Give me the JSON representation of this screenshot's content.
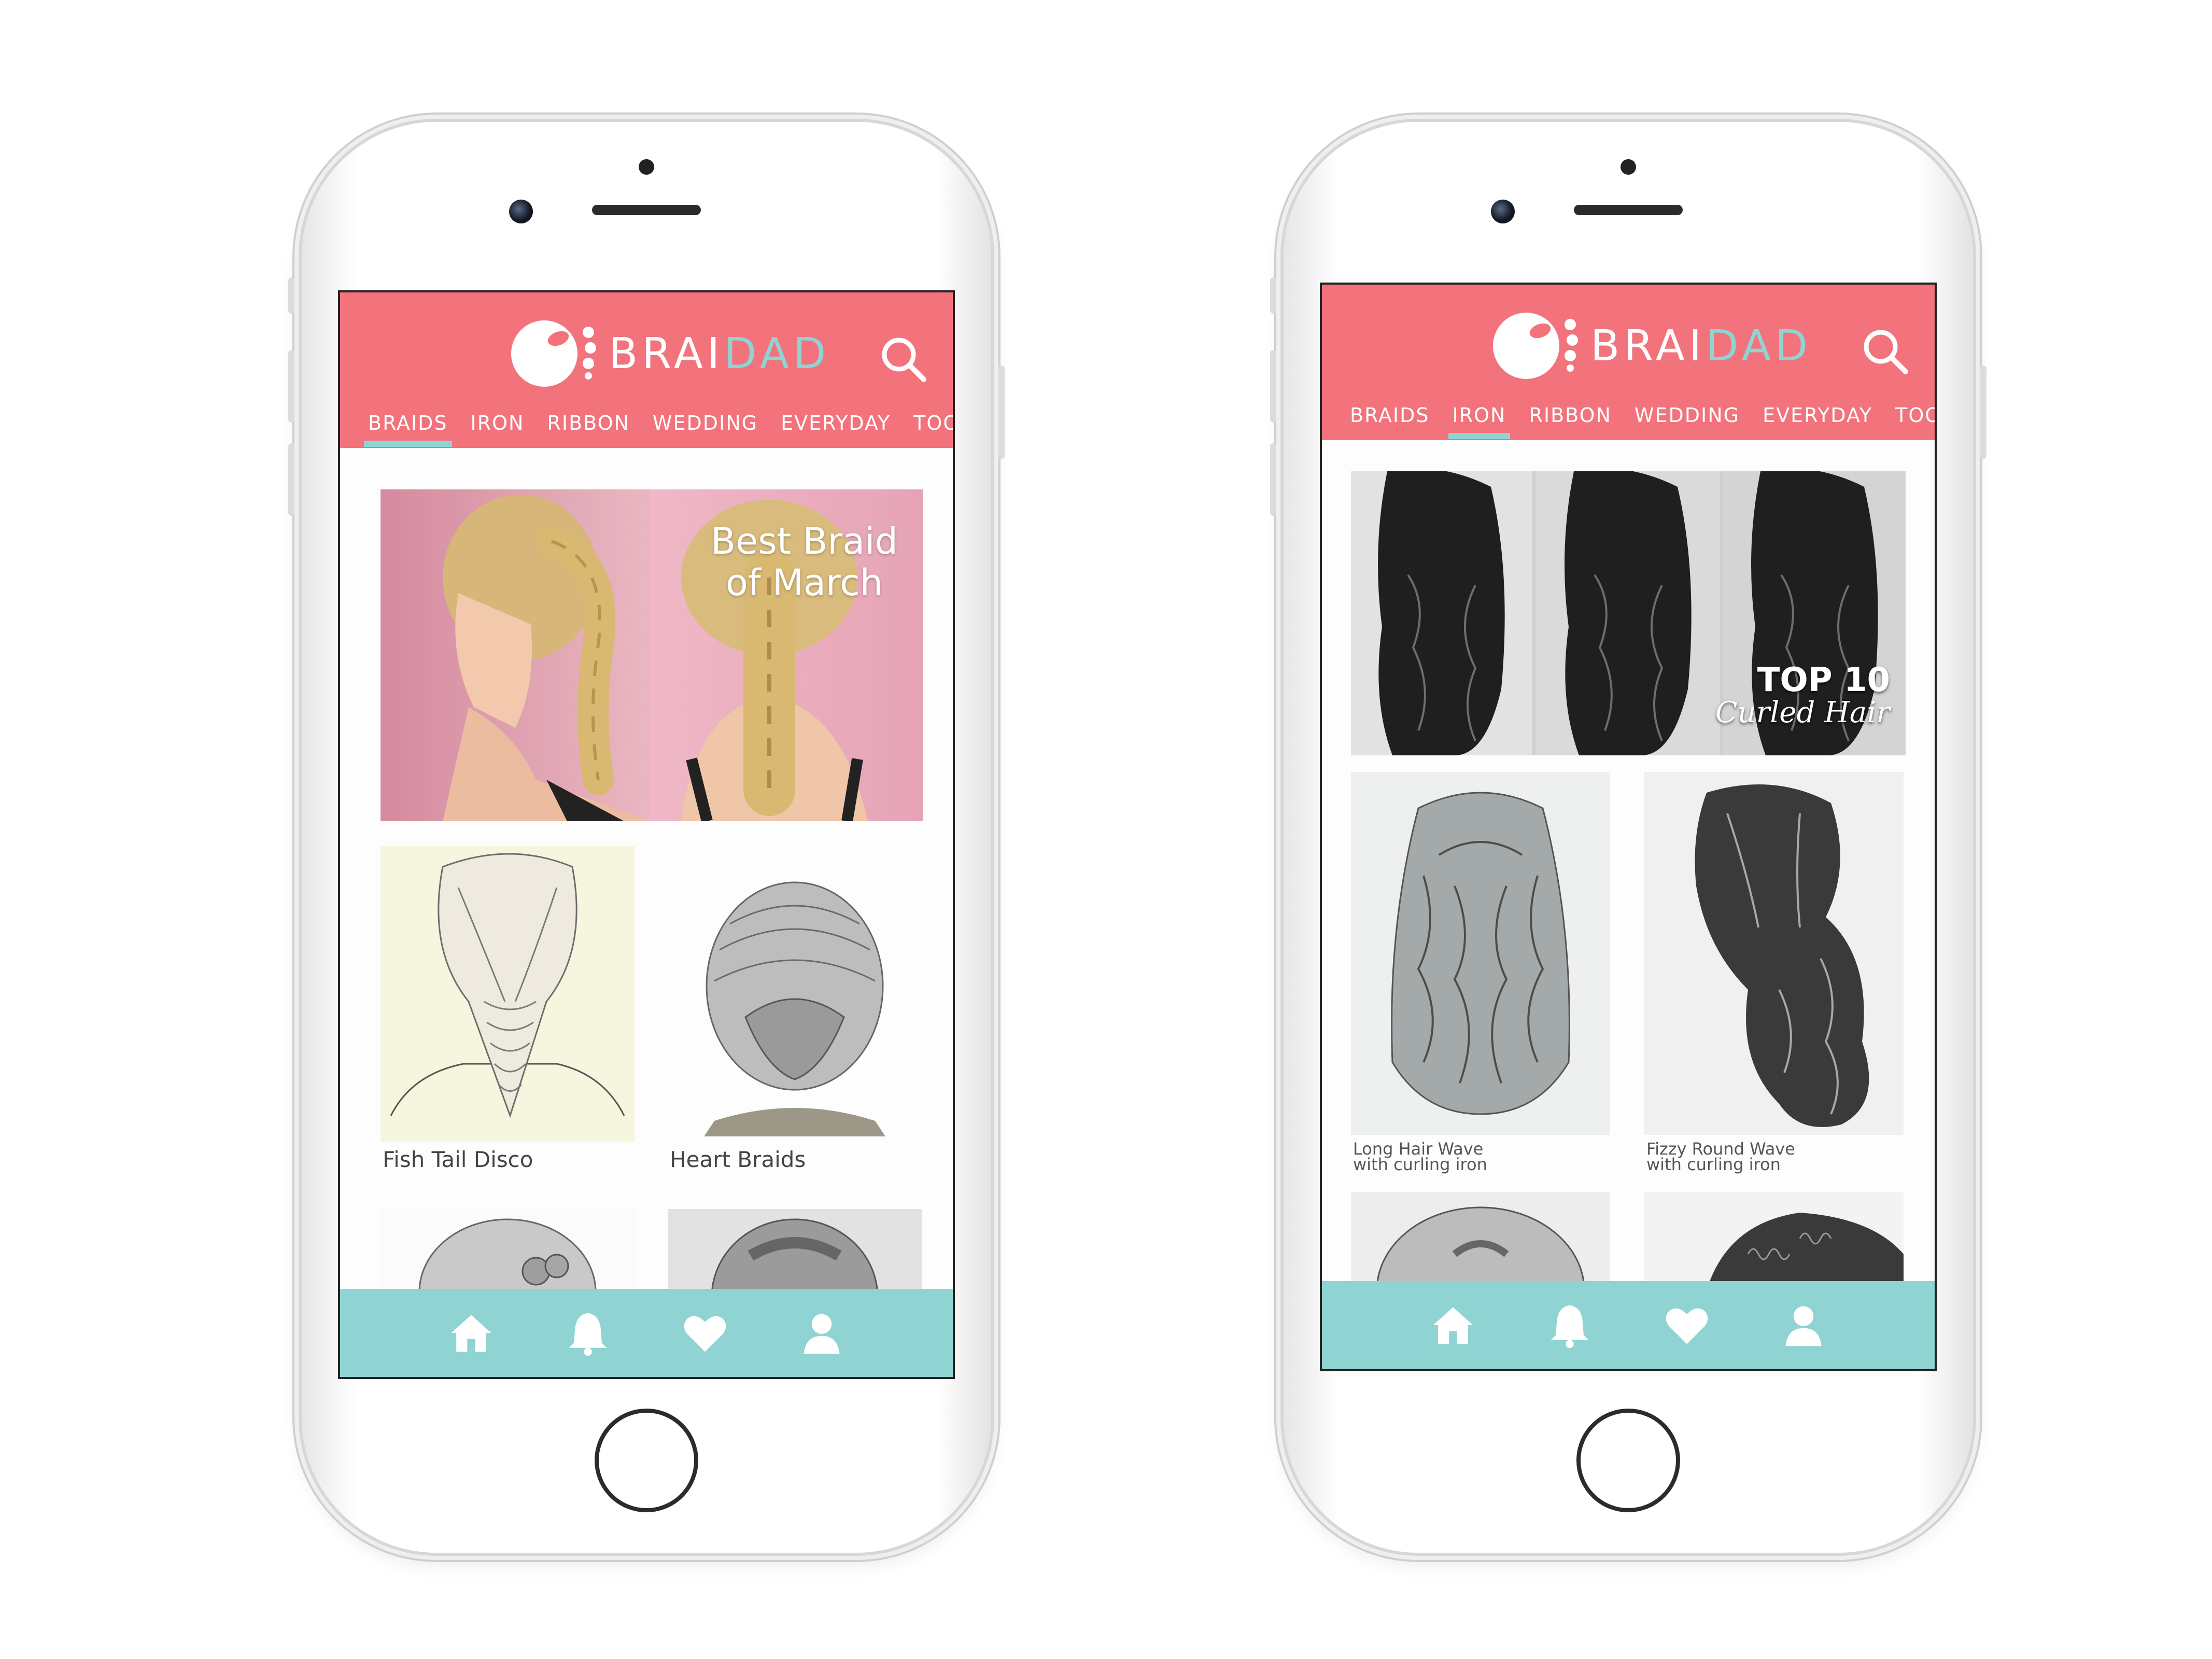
{
  "colors": {
    "appbar": "#f2737c",
    "accent": "#8fd3d2",
    "bottombar": "#8fd3d2"
  },
  "left_phone": {
    "brand": {
      "part1": "BRAI",
      "part2": "DAD"
    },
    "tabs": [
      {
        "label": "BRAIDS",
        "active": true
      },
      {
        "label": "IRON"
      },
      {
        "label": "RIBBON"
      },
      {
        "label": "WEDDING"
      },
      {
        "label": "EVERYDAY"
      },
      {
        "label": "TOOLS"
      }
    ],
    "hero": {
      "line1": "Best Braid",
      "line2": "of March"
    },
    "cards": [
      {
        "caption": "Fish Tail Disco"
      },
      {
        "caption": "Heart Braids"
      }
    ],
    "bottom_nav": [
      "home-icon",
      "bell-icon",
      "heart-icon",
      "user-icon"
    ]
  },
  "right_phone": {
    "brand": {
      "part1": "BRAI",
      "part2": "DAD"
    },
    "tabs": [
      {
        "label": "BRAIDS"
      },
      {
        "label": "IRON",
        "active": true
      },
      {
        "label": "RIBBON"
      },
      {
        "label": "WEDDING"
      },
      {
        "label": "EVERYDAY"
      },
      {
        "label": "TOOLS"
      }
    ],
    "hero": {
      "line1": "TOP 10",
      "line2": "Curled Hair"
    },
    "cards": [
      {
        "caption_line1": "Long Hair Wave",
        "caption_line2": "with curling iron"
      },
      {
        "caption_line1": "Fizzy Round Wave",
        "caption_line2": "with curling iron"
      }
    ],
    "bottom_nav": [
      "home-icon",
      "bell-icon",
      "heart-icon",
      "user-icon"
    ]
  }
}
